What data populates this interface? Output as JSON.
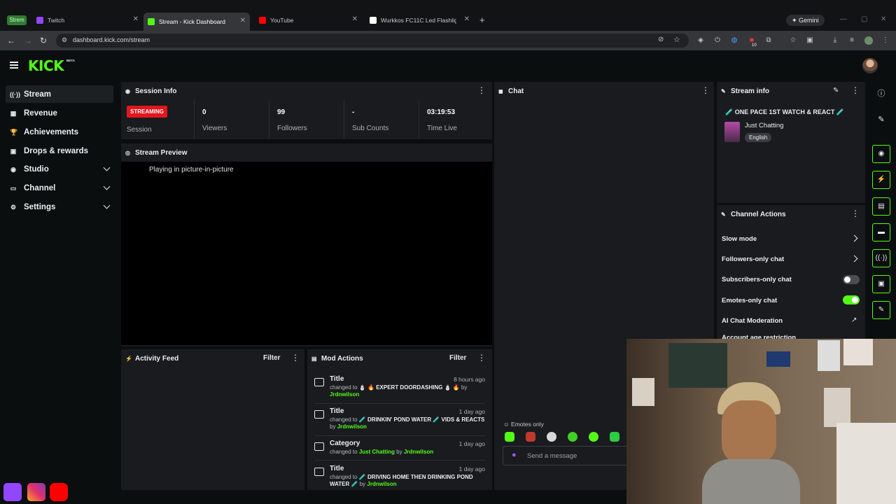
{
  "browser": {
    "profile_badge": "Strem",
    "tabs": [
      {
        "title": "Twitch",
        "color": "#9146ff"
      },
      {
        "title": "Stream - Kick Dashboard",
        "color": "#53fc18"
      },
      {
        "title": "YouTube",
        "color": "#ff0000"
      },
      {
        "title": "Wurkkos FC11C Led Flashlight |",
        "color": "#ffffff"
      }
    ],
    "new_tab": "+",
    "gemini": "✦ Gemini",
    "url": "dashboard.kick.com/stream",
    "ext_badge": "10"
  },
  "header": {
    "logo": "KICK",
    "beta": "BETA"
  },
  "sidebar": {
    "items": [
      {
        "label": "Stream",
        "icon": "broadcast-icon"
      },
      {
        "label": "Revenue",
        "icon": "chart-icon"
      },
      {
        "label": "Achievements",
        "icon": "trophy-icon"
      },
      {
        "label": "Drops & rewards",
        "icon": "gift-icon"
      },
      {
        "label": "Studio",
        "icon": "studio-icon"
      },
      {
        "label": "Channel",
        "icon": "channel-icon"
      },
      {
        "label": "Settings",
        "icon": "gear-icon"
      }
    ]
  },
  "session": {
    "title": "Session Info",
    "badge": "STREAMING",
    "session_label": "Session",
    "stats": [
      {
        "value": "0",
        "label": "Viewers"
      },
      {
        "value": "99",
        "label": "Followers"
      },
      {
        "value": "-",
        "label": "Sub Counts"
      },
      {
        "value": "03:19:53",
        "label": "Time Live"
      }
    ]
  },
  "preview": {
    "title": "Stream Preview",
    "pip_text": "Playing in picture-in-picture"
  },
  "activity": {
    "title": "Activity Feed",
    "filter": "Filter"
  },
  "mod": {
    "title": "Mod Actions",
    "filter": "Filter",
    "items": [
      {
        "title": "Title",
        "time": "8 hours ago",
        "prefix": "changed to",
        "value": "⛄ 🔥 EXPERT DOORDASHING ⛄ 🔥",
        "by": "by",
        "user": "Jrdnwilson"
      },
      {
        "title": "Title",
        "time": "1 day ago",
        "prefix": "changed to",
        "value": "🧪 DRINKIN' POND WATER 🧪 VIDS & REACTS",
        "by": "by",
        "user": "Jrdnwilson"
      },
      {
        "title": "Category",
        "time": "1 day ago",
        "prefix": "changed to",
        "value": "Just Chatting",
        "by": "by",
        "user": "Jrdnwilson"
      },
      {
        "title": "Title",
        "time": "1 day ago",
        "prefix": "changed to",
        "value": "🧪 DRIVING HOME THEN DRINKING POND WATER 🧪",
        "by": "by",
        "user": "Jrdnwilson"
      }
    ]
  },
  "chat": {
    "title": "Chat",
    "emotes_only": "Emotes only",
    "placeholder": "Send a message"
  },
  "stream_info": {
    "title": "Stream info",
    "stream_title": "🧪 ONE PACE 1ST WATCH & REACT 🧪",
    "category": "Just Chatting",
    "language": "English"
  },
  "channel_actions": {
    "title": "Channel Actions",
    "rows": [
      {
        "label": "Slow mode"
      },
      {
        "label": "Followers-only chat"
      },
      {
        "label": "Subscribers-only chat"
      },
      {
        "label": "Emotes-only chat"
      },
      {
        "label": "AI Chat Moderation"
      },
      {
        "label": "Account age restriction"
      }
    ],
    "colors": {
      "toggle_on": "#53fc18",
      "toggle_off": "#4a4d52"
    }
  },
  "colors": {
    "accent": "#53fc18",
    "live": "#e3151d"
  }
}
